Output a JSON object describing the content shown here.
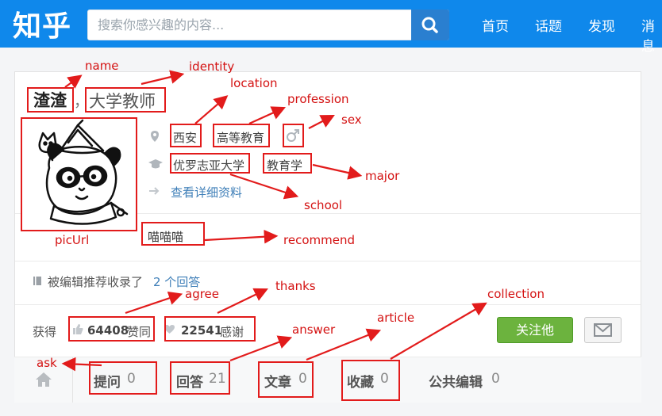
{
  "header": {
    "logo": "知乎",
    "search_placeholder": "搜索你感兴趣的内容...",
    "nav": [
      "首页",
      "话题",
      "发现",
      "消息"
    ]
  },
  "profile": {
    "name": "渣渣",
    "separator": "，",
    "identity": "大学教师",
    "location": "西安",
    "profession": "高等教育",
    "school": "优罗志亚大学",
    "major": "教育学",
    "detail_link": "查看详细资料",
    "recommend": "喵喵喵",
    "collected_text": "被编辑推荐收录了",
    "collected_link": "2 个回答",
    "gain_label": "获得",
    "agree_count": "64408",
    "agree_label": "赞同",
    "thanks_count": "22541",
    "thanks_label": "感谢",
    "follow_button": "关注他"
  },
  "tabs": [
    {
      "label": "提问",
      "count": "0"
    },
    {
      "label": "回答",
      "count": "21"
    },
    {
      "label": "文章",
      "count": "0"
    },
    {
      "label": "收藏",
      "count": "0"
    },
    {
      "label": "公共编辑",
      "count": "0"
    }
  ],
  "annotations": {
    "name": "name",
    "identity": "identity",
    "location": "location",
    "profession": "profession",
    "sex": "sex",
    "major": "major",
    "school": "school",
    "picUrl": "picUrl",
    "recommend": "recommend",
    "agree": "agree",
    "thanks": "thanks",
    "answer": "answer",
    "article": "article",
    "collection": "collection",
    "ask": "ask"
  },
  "colors": {
    "header": "#0f88eb",
    "annotation": "#e21b1b",
    "follow": "#6cb33e",
    "link": "#3f7fb8"
  }
}
